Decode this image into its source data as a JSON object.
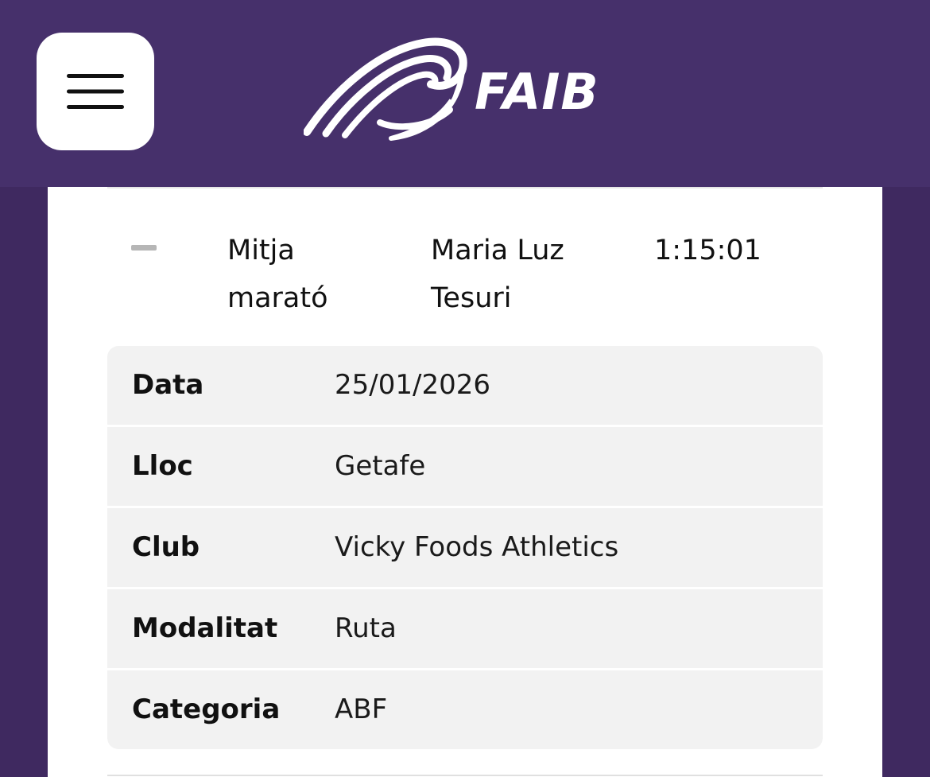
{
  "header": {
    "brand_name": "FAIB",
    "menu_icon": "hamburger-menu-icon",
    "logo_icon": "faib-swirl-logo-icon",
    "background_color": "#46306b"
  },
  "result": {
    "collapse_icon": "minus-icon",
    "event_line1": "Mitja",
    "event_line2": "marató",
    "athlete_line1": "Maria Luz",
    "athlete_line2": "Tesuri",
    "time": "1:15:01"
  },
  "details": [
    {
      "label": "Data",
      "value": "25/01/2026"
    },
    {
      "label": "Lloc",
      "value": "Getafe"
    },
    {
      "label": "Club",
      "value": "Vicky Foods Athletics"
    },
    {
      "label": "Modalitat",
      "value": "Ruta"
    },
    {
      "label": "Categoria",
      "value": "ABF"
    }
  ]
}
